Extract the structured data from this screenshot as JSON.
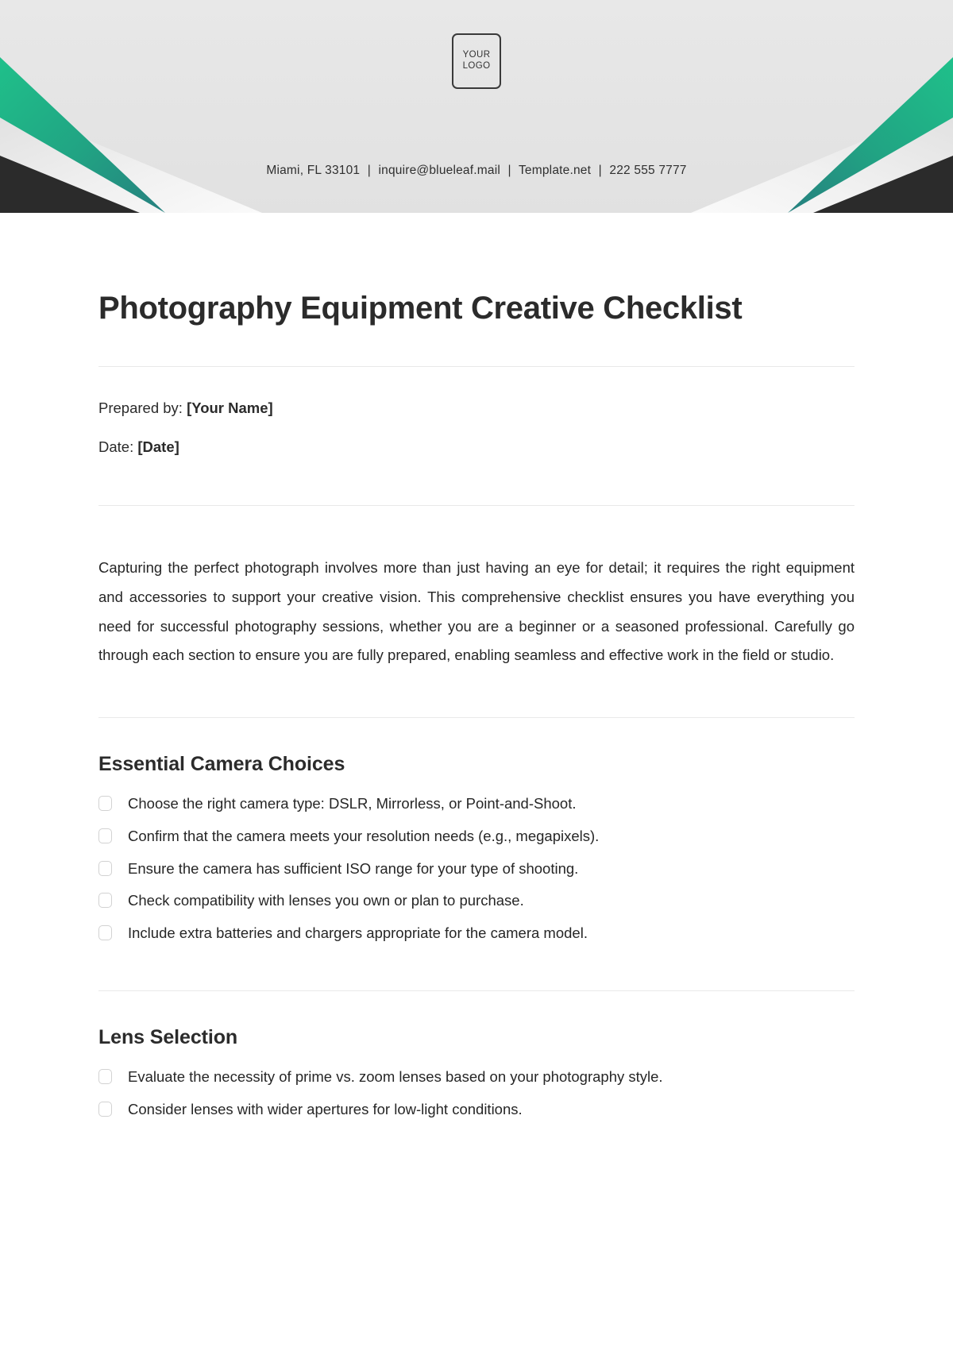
{
  "header": {
    "logo": {
      "line1": "YOUR",
      "line2": "LOGO"
    },
    "contact": {
      "address": "Miami, FL 33101",
      "email": "inquire@blueleaf.mail",
      "website": "Template.net",
      "phone": "222 555 7777",
      "separator": "|"
    },
    "colors": {
      "background": "#e4e4e4",
      "accent_green": "#1fb584",
      "accent_dark": "#2b2b2b",
      "accent_light": "#ededed"
    }
  },
  "document": {
    "title": "Photography Equipment Creative Checklist",
    "meta": [
      {
        "label": "Prepared by:",
        "value": "[Your Name]"
      },
      {
        "label": "Date:",
        "value": "[Date]"
      }
    ],
    "intro": "Capturing the perfect photograph involves more than just having an eye for detail; it requires the right equipment and accessories to support your creative vision. This comprehensive checklist ensures you have everything you need for successful photography sessions, whether you are a beginner or a seasoned professional. Carefully go through each section to ensure you are fully prepared, enabling seamless and effective work in the field or studio.",
    "sections": [
      {
        "title": "Essential Camera Choices",
        "items": [
          "Choose the right camera type: DSLR, Mirrorless, or Point-and-Shoot.",
          "Confirm that the camera meets your resolution needs (e.g., megapixels).",
          "Ensure the camera has sufficient ISO range for your type of shooting.",
          "Check compatibility with lenses you own or plan to purchase.",
          "Include extra batteries and chargers appropriate for the camera model."
        ]
      },
      {
        "title": "Lens Selection",
        "items": [
          "Evaluate the necessity of prime vs. zoom lenses based on your photography style.",
          "Consider lenses with wider apertures for low-light conditions."
        ]
      }
    ]
  }
}
